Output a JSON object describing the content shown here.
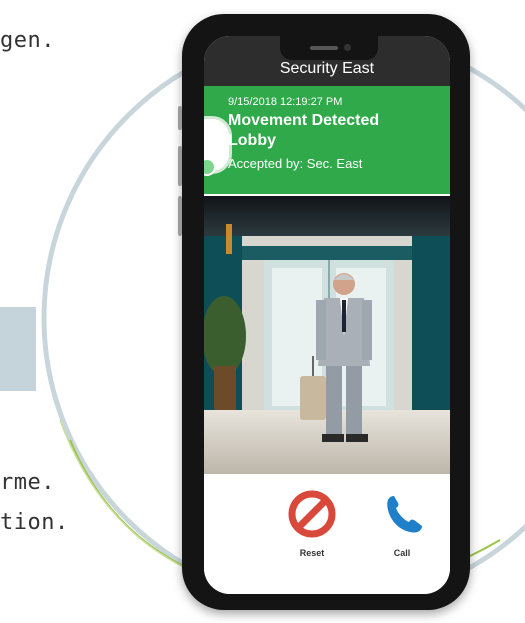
{
  "page_fragments": {
    "top": "gen.",
    "bottom1": "rme.",
    "bottom2": "tion."
  },
  "app": {
    "title": "Security East"
  },
  "alert": {
    "timestamp": "9/15/2018 12:19:27 PM",
    "line1": "Movement Detected",
    "line2": "Lobby",
    "accepted": "Accepted by: Sec. East",
    "color": "#2fa94a"
  },
  "actions": {
    "reset_label": "Reset",
    "call_label": "Call",
    "reset_icon": "prohibited-icon",
    "call_icon": "phone-icon",
    "reset_color": "#d9493b",
    "call_color": "#1f7fc9"
  }
}
